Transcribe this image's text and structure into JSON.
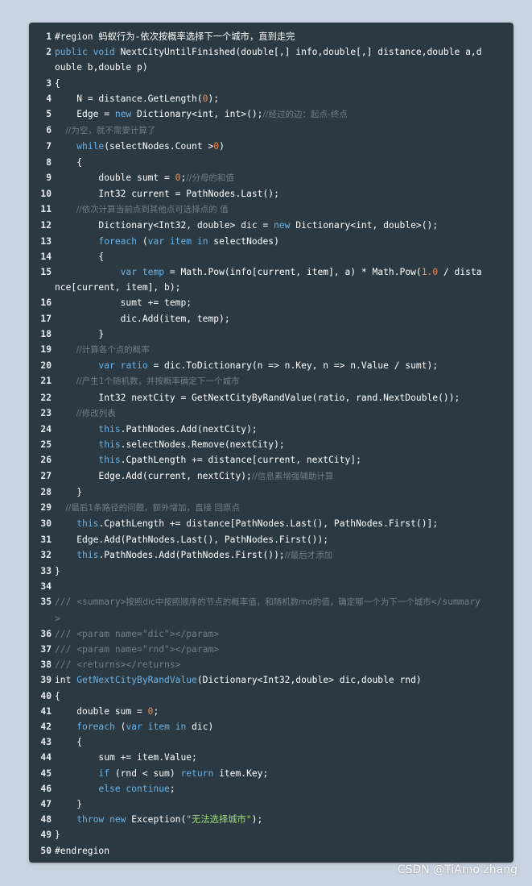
{
  "lines": [
    {
      "n": "1",
      "t": [
        {
          "c": "p",
          "s": "#region 蚂蚁行为-依次按概率选择下一个城市，直到走完"
        }
      ]
    },
    {
      "n": "2",
      "t": [
        {
          "c": "kw",
          "s": "public void "
        },
        {
          "c": "p",
          "s": "NextCityUntilFinished(double[,] info,double[,] distance,double a,double b,double p)"
        }
      ]
    },
    {
      "n": "3",
      "t": [
        {
          "c": "p",
          "s": "{"
        }
      ]
    },
    {
      "n": "4",
      "t": [
        {
          "c": "p",
          "s": "    N = distance.GetLength("
        },
        {
          "c": "num",
          "s": "0"
        },
        {
          "c": "p",
          "s": ");"
        }
      ]
    },
    {
      "n": "5",
      "t": [
        {
          "c": "p",
          "s": "    Edge = "
        },
        {
          "c": "kw",
          "s": "new "
        },
        {
          "c": "p",
          "s": "Dictionary<int, int>();"
        },
        {
          "c": "cm",
          "s": "//经过的边：起点-终点"
        }
      ]
    },
    {
      "n": "6",
      "t": [
        {
          "c": "cm",
          "s": "    //为空，就不需要计算了"
        }
      ]
    },
    {
      "n": "7",
      "t": [
        {
          "c": "kw",
          "s": "    while"
        },
        {
          "c": "p",
          "s": "(selectNodes.Count >"
        },
        {
          "c": "num",
          "s": "0"
        },
        {
          "c": "p",
          "s": ")"
        }
      ]
    },
    {
      "n": "8",
      "t": [
        {
          "c": "p",
          "s": "    {"
        }
      ]
    },
    {
      "n": "9",
      "t": [
        {
          "c": "p",
          "s": "        double sumt = "
        },
        {
          "c": "num",
          "s": "0"
        },
        {
          "c": "p",
          "s": ";"
        },
        {
          "c": "cm",
          "s": "//分母的和值"
        }
      ]
    },
    {
      "n": "10",
      "t": [
        {
          "c": "p",
          "s": "        Int32 current = PathNodes.Last();"
        }
      ]
    },
    {
      "n": "11",
      "t": [
        {
          "c": "cm",
          "s": "        //依次计算当前点到其他点可选择点的 值"
        }
      ]
    },
    {
      "n": "12",
      "t": [
        {
          "c": "p",
          "s": "        Dictionary<Int32, double> dic = "
        },
        {
          "c": "kw",
          "s": "new "
        },
        {
          "c": "p",
          "s": "Dictionary<int, double>();"
        }
      ]
    },
    {
      "n": "13",
      "t": [
        {
          "c": "kw",
          "s": "        foreach "
        },
        {
          "c": "p",
          "s": "("
        },
        {
          "c": "kw",
          "s": "var "
        },
        {
          "c": "var",
          "s": "item "
        },
        {
          "c": "kw",
          "s": "in "
        },
        {
          "c": "p",
          "s": "selectNodes)"
        }
      ]
    },
    {
      "n": "14",
      "t": [
        {
          "c": "p",
          "s": "        {"
        }
      ]
    },
    {
      "n": "15",
      "t": [
        {
          "c": "kw",
          "s": "            var "
        },
        {
          "c": "var",
          "s": "temp "
        },
        {
          "c": "p",
          "s": "= Math.Pow(info[current, item], a) * Math.Pow("
        },
        {
          "c": "num",
          "s": "1.0"
        },
        {
          "c": "p",
          "s": " / distance[current, item], b);"
        }
      ]
    },
    {
      "n": "16",
      "t": [
        {
          "c": "p",
          "s": "            sumt += temp;"
        }
      ]
    },
    {
      "n": "17",
      "t": [
        {
          "c": "p",
          "s": "            dic.Add(item, temp);"
        }
      ]
    },
    {
      "n": "18",
      "t": [
        {
          "c": "p",
          "s": "        }"
        }
      ]
    },
    {
      "n": "19",
      "t": [
        {
          "c": "cm",
          "s": "        //计算各个点的概率"
        }
      ]
    },
    {
      "n": "20",
      "t": [
        {
          "c": "kw",
          "s": "        var "
        },
        {
          "c": "var",
          "s": "ratio "
        },
        {
          "c": "p",
          "s": "= dic.ToDictionary(n => n.Key, n => n.Value / sumt);"
        }
      ]
    },
    {
      "n": "21",
      "t": [
        {
          "c": "cm",
          "s": "        //产生1个随机数，并按概率确定下一个城市"
        }
      ]
    },
    {
      "n": "22",
      "t": [
        {
          "c": "p",
          "s": "        Int32 nextCity = GetNextCityByRandValue(ratio, rand.NextDouble());"
        }
      ]
    },
    {
      "n": "23",
      "t": [
        {
          "c": "cm",
          "s": "        //修改列表"
        }
      ]
    },
    {
      "n": "24",
      "t": [
        {
          "c": "kw",
          "s": "        this"
        },
        {
          "c": "p",
          "s": ".PathNodes.Add(nextCity);"
        }
      ]
    },
    {
      "n": "25",
      "t": [
        {
          "c": "kw",
          "s": "        this"
        },
        {
          "c": "p",
          "s": ".selectNodes.Remove(nextCity);"
        }
      ]
    },
    {
      "n": "26",
      "t": [
        {
          "c": "kw",
          "s": "        this"
        },
        {
          "c": "p",
          "s": ".CpathLength += distance[current, nextCity];"
        }
      ]
    },
    {
      "n": "27",
      "t": [
        {
          "c": "p",
          "s": "        Edge.Add(current, nextCity);"
        },
        {
          "c": "cm",
          "s": "//信息素增强辅助计算"
        }
      ]
    },
    {
      "n": "28",
      "t": [
        {
          "c": "p",
          "s": "    }"
        }
      ]
    },
    {
      "n": "29",
      "t": [
        {
          "c": "cm",
          "s": "    //最后1条路径的问题，额外增加，直接 回原点"
        }
      ]
    },
    {
      "n": "30",
      "t": [
        {
          "c": "kw",
          "s": "    this"
        },
        {
          "c": "p",
          "s": ".CpathLength += distance[PathNodes.Last(), PathNodes.First()];"
        }
      ]
    },
    {
      "n": "31",
      "t": [
        {
          "c": "p",
          "s": "    Edge.Add(PathNodes.Last(), PathNodes.First());"
        }
      ]
    },
    {
      "n": "32",
      "t": [
        {
          "c": "kw",
          "s": "    this"
        },
        {
          "c": "p",
          "s": ".PathNodes.Add(PathNodes.First());"
        },
        {
          "c": "cm",
          "s": "//最后才添加"
        }
      ]
    },
    {
      "n": "33",
      "t": [
        {
          "c": "p",
          "s": "}"
        }
      ]
    },
    {
      "n": "34",
      "t": [
        {
          "c": "p",
          "s": ""
        }
      ]
    },
    {
      "n": "35",
      "t": [
        {
          "c": "tag",
          "s": "/// <summary>"
        },
        {
          "c": "cm",
          "s": "按照dic中按照顺序的节点的概率值，和随机数rnd的值，确定哪一个为下一个城市"
        },
        {
          "c": "tag",
          "s": "</summary>"
        }
      ]
    },
    {
      "n": "36",
      "t": [
        {
          "c": "tag",
          "s": "/// <param name=\"dic\"></param>"
        }
      ]
    },
    {
      "n": "37",
      "t": [
        {
          "c": "tag",
          "s": "/// <param name=\"rnd\"></param>"
        }
      ]
    },
    {
      "n": "38",
      "t": [
        {
          "c": "tag",
          "s": "/// <returns></returns>"
        }
      ]
    },
    {
      "n": "39",
      "t": [
        {
          "c": "p",
          "s": "int "
        },
        {
          "c": "fn",
          "s": "GetNextCityByRandValue"
        },
        {
          "c": "p",
          "s": "(Dictionary<Int32,double> dic,double rnd)"
        }
      ]
    },
    {
      "n": "40",
      "t": [
        {
          "c": "p",
          "s": "{"
        }
      ]
    },
    {
      "n": "41",
      "t": [
        {
          "c": "p",
          "s": "    double sum = "
        },
        {
          "c": "num",
          "s": "0"
        },
        {
          "c": "p",
          "s": ";"
        }
      ]
    },
    {
      "n": "42",
      "t": [
        {
          "c": "kw",
          "s": "    foreach "
        },
        {
          "c": "p",
          "s": "("
        },
        {
          "c": "kw",
          "s": "var "
        },
        {
          "c": "var",
          "s": "item "
        },
        {
          "c": "kw",
          "s": "in "
        },
        {
          "c": "p",
          "s": "dic)"
        }
      ]
    },
    {
      "n": "43",
      "t": [
        {
          "c": "p",
          "s": "    {"
        }
      ]
    },
    {
      "n": "44",
      "t": [
        {
          "c": "p",
          "s": "        sum += item.Value;"
        }
      ]
    },
    {
      "n": "45",
      "t": [
        {
          "c": "kw",
          "s": "        if "
        },
        {
          "c": "p",
          "s": "(rnd < sum) "
        },
        {
          "c": "kw",
          "s": "return "
        },
        {
          "c": "p",
          "s": "item.Key;"
        }
      ]
    },
    {
      "n": "46",
      "t": [
        {
          "c": "kw",
          "s": "        else continue"
        },
        {
          "c": "p",
          "s": ";"
        }
      ]
    },
    {
      "n": "47",
      "t": [
        {
          "c": "p",
          "s": "    }"
        }
      ]
    },
    {
      "n": "48",
      "t": [
        {
          "c": "kw",
          "s": "    throw new "
        },
        {
          "c": "p",
          "s": "Exception("
        },
        {
          "c": "str",
          "s": "\"无法选择城市\""
        },
        {
          "c": "p",
          "s": ");"
        }
      ]
    },
    {
      "n": "49",
      "t": [
        {
          "c": "p",
          "s": "}"
        }
      ]
    },
    {
      "n": "50",
      "t": [
        {
          "c": "p",
          "s": "#endregion"
        }
      ]
    }
  ],
  "watermark": "CSDN @TiAmo zhang"
}
